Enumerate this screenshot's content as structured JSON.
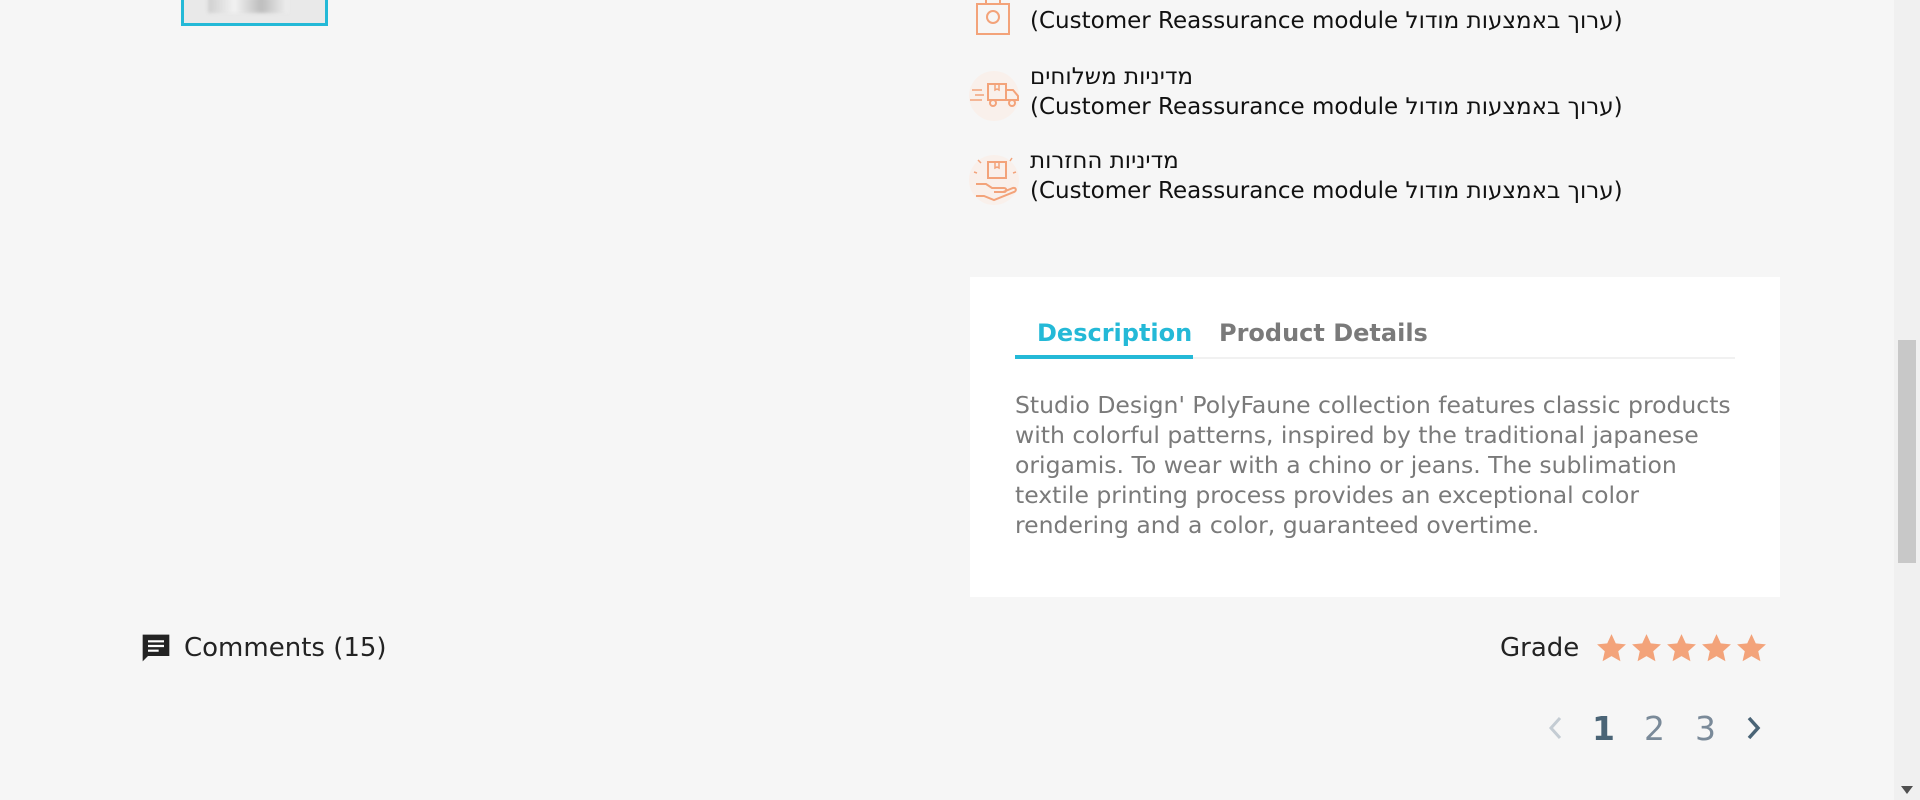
{
  "reassurance": {
    "items": [
      {
        "title": "",
        "desc": "(ערוך באמצעות מודול Customer Reassurance module)",
        "icon": "security-bag-icon"
      },
      {
        "title": "מדיניות משלוחים",
        "desc": "(ערוך באמצעות מודול Customer Reassurance module)",
        "icon": "delivery-truck-icon"
      },
      {
        "title": "מדיניות החזרות",
        "desc": "(ערוך באמצעות מודול Customer Reassurance module)",
        "icon": "return-box-icon"
      }
    ]
  },
  "tabs": {
    "items": [
      {
        "label": "Description",
        "active": true
      },
      {
        "label": "Product Details",
        "active": false
      }
    ],
    "description": "Studio Design' PolyFaune collection features classic products with colorful patterns, inspired by the traditional japanese origamis. To wear with a chino or jeans. The sublimation textile printing process provides an exceptional color rendering and a color, guaranteed overtime."
  },
  "comments": {
    "label": "Comments (15)",
    "icon": "comment-icon"
  },
  "grade": {
    "label": "Grade",
    "rating": 5,
    "max": 5,
    "star_color": "#f3a37a"
  },
  "pagination": {
    "pages": [
      "1",
      "2",
      "3"
    ],
    "current": "1"
  },
  "colors": {
    "accent": "#24b9d7",
    "icon_orange": "#f3a37a"
  }
}
